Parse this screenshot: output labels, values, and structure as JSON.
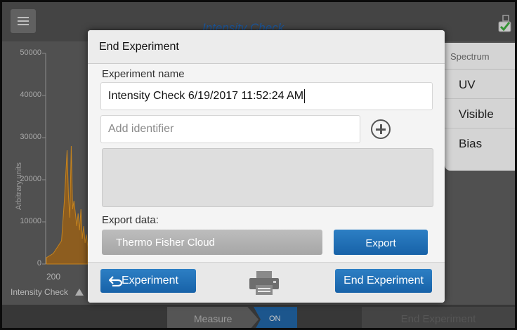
{
  "app": {
    "title": "Intensity Check"
  },
  "chart_data": {
    "type": "area",
    "ylabel": "Arbitrary units",
    "yticks": [
      "50000",
      "40000",
      "30000",
      "20000",
      "10000",
      "0"
    ],
    "xticks": [
      "200"
    ],
    "series": [
      {
        "name": "Intensity Check",
        "color": "#b06a10",
        "x": [
          195,
          200,
          203,
          206,
          208,
          210,
          211,
          212,
          213,
          214,
          215,
          216,
          217,
          218,
          219,
          220,
          221,
          222,
          223,
          224,
          225
        ],
        "values": [
          1500,
          2500,
          4000,
          5500,
          15000,
          27000,
          16000,
          11000,
          28000,
          13000,
          15000,
          12000,
          9000,
          12000,
          8000,
          13000,
          6000,
          9000,
          5000,
          7000,
          4000
        ]
      }
    ]
  },
  "spectrum": {
    "header": "Spectrum",
    "items": [
      "UV",
      "Visible",
      "Bias"
    ]
  },
  "bottom": {
    "measure_label": "Measure",
    "toggle_label": "ON",
    "end_label": "End Experiment"
  },
  "dialog": {
    "title": "End Experiment",
    "name_label": "Experiment name",
    "name_value": "Intensity Check 6/19/2017 11:52:24 AM",
    "identifier_placeholder": "Add identifier",
    "export_label": "Export data:",
    "cloud_label": "Thermo Fisher Cloud",
    "export_button": "Export",
    "back_button": "Experiment",
    "end_button": "End Experiment"
  }
}
